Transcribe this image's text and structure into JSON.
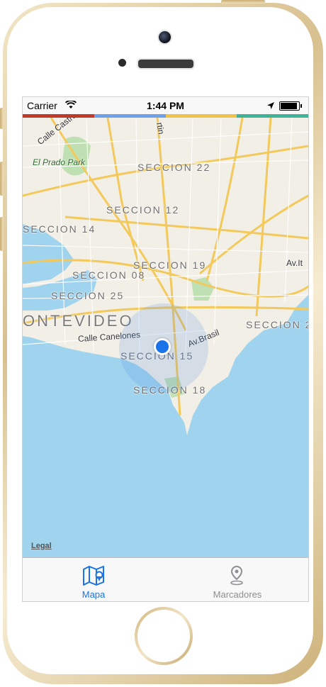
{
  "status_bar": {
    "carrier": "Carrier",
    "time": "1:44 PM"
  },
  "color_strip": [
    "#c0392b",
    "#6fa1e8",
    "#f0c24a",
    "#3fb39a"
  ],
  "map": {
    "labels": {
      "seccion_22": "SECCION 22",
      "seccion_12": "SECCION 12",
      "seccion_14": "SECCION 14",
      "seccion_19": "SECCION 19",
      "seccion_08": "SECCION 08",
      "seccion_25": "SECCION 25",
      "seccion_15": "SECCION 15",
      "seccion_18": "SECCION 18",
      "seccion_2": "SECCION 2",
      "city": "ONTEVIDEO",
      "calle_castro": "Calle Castro",
      "el_prado_park": "El Prado Park",
      "calle_canelones": "Calle Canelones",
      "av_brasil": "Av.Brasil",
      "av_it": "Av.It",
      "rtin": "rtin"
    },
    "legal": "Legal"
  },
  "tabs": [
    {
      "label": "Mapa",
      "icon": "map-icon",
      "active": true
    },
    {
      "label": "Marcadores",
      "icon": "location-pin-icon",
      "active": false
    }
  ],
  "colors": {
    "accent": "#1a73e8",
    "inactive": "#8e8e93",
    "water": "#9fd3ee",
    "land": "#f2efe6",
    "road": "#f6d47a"
  }
}
